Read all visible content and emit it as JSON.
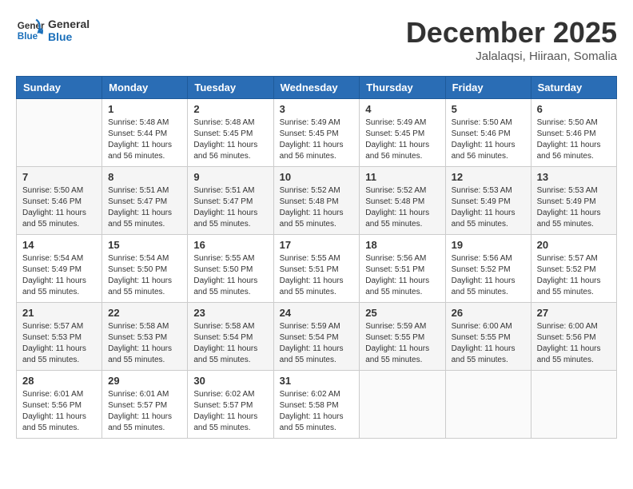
{
  "logo": {
    "line1": "General",
    "line2": "Blue"
  },
  "title": "December 2025",
  "subtitle": "Jalalaqsi, Hiiraan, Somalia",
  "weekdays": [
    "Sunday",
    "Monday",
    "Tuesday",
    "Wednesday",
    "Thursday",
    "Friday",
    "Saturday"
  ],
  "weeks": [
    [
      {
        "day": "",
        "info": ""
      },
      {
        "day": "1",
        "info": "Sunrise: 5:48 AM\nSunset: 5:44 PM\nDaylight: 11 hours\nand 56 minutes."
      },
      {
        "day": "2",
        "info": "Sunrise: 5:48 AM\nSunset: 5:45 PM\nDaylight: 11 hours\nand 56 minutes."
      },
      {
        "day": "3",
        "info": "Sunrise: 5:49 AM\nSunset: 5:45 PM\nDaylight: 11 hours\nand 56 minutes."
      },
      {
        "day": "4",
        "info": "Sunrise: 5:49 AM\nSunset: 5:45 PM\nDaylight: 11 hours\nand 56 minutes."
      },
      {
        "day": "5",
        "info": "Sunrise: 5:50 AM\nSunset: 5:46 PM\nDaylight: 11 hours\nand 56 minutes."
      },
      {
        "day": "6",
        "info": "Sunrise: 5:50 AM\nSunset: 5:46 PM\nDaylight: 11 hours\nand 56 minutes."
      }
    ],
    [
      {
        "day": "7",
        "info": ""
      },
      {
        "day": "8",
        "info": "Sunrise: 5:51 AM\nSunset: 5:47 PM\nDaylight: 11 hours\nand 55 minutes."
      },
      {
        "day": "9",
        "info": "Sunrise: 5:51 AM\nSunset: 5:47 PM\nDaylight: 11 hours\nand 55 minutes."
      },
      {
        "day": "10",
        "info": "Sunrise: 5:52 AM\nSunset: 5:48 PM\nDaylight: 11 hours\nand 55 minutes."
      },
      {
        "day": "11",
        "info": "Sunrise: 5:52 AM\nSunset: 5:48 PM\nDaylight: 11 hours\nand 55 minutes."
      },
      {
        "day": "12",
        "info": "Sunrise: 5:53 AM\nSunset: 5:49 PM\nDaylight: 11 hours\nand 55 minutes."
      },
      {
        "day": "13",
        "info": "Sunrise: 5:53 AM\nSunset: 5:49 PM\nDaylight: 11 hours\nand 55 minutes."
      }
    ],
    [
      {
        "day": "14",
        "info": ""
      },
      {
        "day": "15",
        "info": "Sunrise: 5:54 AM\nSunset: 5:50 PM\nDaylight: 11 hours\nand 55 minutes."
      },
      {
        "day": "16",
        "info": "Sunrise: 5:55 AM\nSunset: 5:50 PM\nDaylight: 11 hours\nand 55 minutes."
      },
      {
        "day": "17",
        "info": "Sunrise: 5:55 AM\nSunset: 5:51 PM\nDaylight: 11 hours\nand 55 minutes."
      },
      {
        "day": "18",
        "info": "Sunrise: 5:56 AM\nSunset: 5:51 PM\nDaylight: 11 hours\nand 55 minutes."
      },
      {
        "day": "19",
        "info": "Sunrise: 5:56 AM\nSunset: 5:52 PM\nDaylight: 11 hours\nand 55 minutes."
      },
      {
        "day": "20",
        "info": "Sunrise: 5:57 AM\nSunset: 5:52 PM\nDaylight: 11 hours\nand 55 minutes."
      }
    ],
    [
      {
        "day": "21",
        "info": ""
      },
      {
        "day": "22",
        "info": "Sunrise: 5:58 AM\nSunset: 5:53 PM\nDaylight: 11 hours\nand 55 minutes."
      },
      {
        "day": "23",
        "info": "Sunrise: 5:58 AM\nSunset: 5:54 PM\nDaylight: 11 hours\nand 55 minutes."
      },
      {
        "day": "24",
        "info": "Sunrise: 5:59 AM\nSunset: 5:54 PM\nDaylight: 11 hours\nand 55 minutes."
      },
      {
        "day": "25",
        "info": "Sunrise: 5:59 AM\nSunset: 5:55 PM\nDaylight: 11 hours\nand 55 minutes."
      },
      {
        "day": "26",
        "info": "Sunrise: 6:00 AM\nSunset: 5:55 PM\nDaylight: 11 hours\nand 55 minutes."
      },
      {
        "day": "27",
        "info": "Sunrise: 6:00 AM\nSunset: 5:56 PM\nDaylight: 11 hours\nand 55 minutes."
      }
    ],
    [
      {
        "day": "28",
        "info": "Sunrise: 6:01 AM\nSunset: 5:56 PM\nDaylight: 11 hours\nand 55 minutes."
      },
      {
        "day": "29",
        "info": "Sunrise: 6:01 AM\nSunset: 5:57 PM\nDaylight: 11 hours\nand 55 minutes."
      },
      {
        "day": "30",
        "info": "Sunrise: 6:02 AM\nSunset: 5:57 PM\nDaylight: 11 hours\nand 55 minutes."
      },
      {
        "day": "31",
        "info": "Sunrise: 6:02 AM\nSunset: 5:58 PM\nDaylight: 11 hours\nand 55 minutes."
      },
      {
        "day": "",
        "info": ""
      },
      {
        "day": "",
        "info": ""
      },
      {
        "day": "",
        "info": ""
      }
    ]
  ],
  "week1_day7_info": "Sunrise: 5:50 AM\nSunset: 5:46 PM\nDaylight: 11 hours\nand 56 minutes.",
  "week2_day1_info": "Sunrise: 5:50 AM\nSunset: 5:46 PM\nDaylight: 11 hours\nand 55 minutes.",
  "week3_day1_info": "Sunrise: 5:54 AM\nSunset: 5:49 PM\nDaylight: 11 hours\nand 55 minutes.",
  "week4_day1_info": "Sunrise: 5:57 AM\nSunset: 5:52 PM\nDaylight: 11 hours\nand 55 minutes."
}
